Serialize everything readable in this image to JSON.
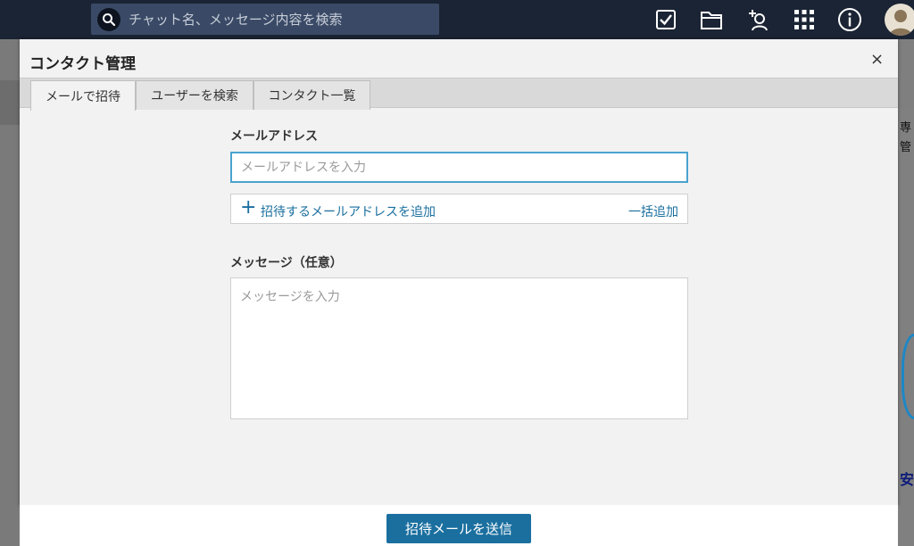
{
  "topbar": {
    "search_placeholder": "チャット名、メッセージ内容を検索",
    "icons": [
      "search-icon",
      "tasks-icon",
      "files-icon",
      "add-contact-icon",
      "apps-grid-icon",
      "info-icon",
      "avatar"
    ]
  },
  "background": {
    "right_text_1": "専",
    "right_text_2": "管",
    "right_text_3": "安"
  },
  "modal": {
    "title": "コンタクト管理",
    "close_label": "×",
    "tabs": [
      {
        "label": "メールで招待",
        "active": true
      },
      {
        "label": "ユーザーを検索",
        "active": false
      },
      {
        "label": "コンタクト一覧",
        "active": false
      }
    ],
    "email": {
      "label": "メールアドレス",
      "placeholder": "メールアドレスを入力",
      "value": ""
    },
    "add_email": {
      "icon": "plus-icon",
      "plus": "+",
      "label": "招待するメールアドレスを追加",
      "bulk_label": "一括追加"
    },
    "message": {
      "label": "メッセージ（任意）",
      "placeholder": "メッセージを入力",
      "value": ""
    }
  },
  "footer": {
    "send_label": "招待メールを送信"
  },
  "colors": {
    "topbar": "#1b2434",
    "accent": "#1a6f9f",
    "focus_border": "#4aa3cf"
  }
}
